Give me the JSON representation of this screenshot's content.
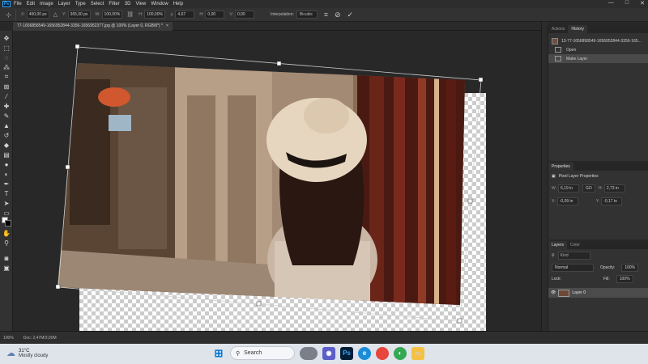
{
  "app": {
    "logo_text": "Ps"
  },
  "menu": [
    "File",
    "Edit",
    "Image",
    "Layer",
    "Type",
    "Select",
    "Filter",
    "3D",
    "View",
    "Window",
    "Help"
  ],
  "window_controls": [
    "—",
    "□",
    "✕"
  ],
  "options_bar": {
    "x_label": "X:",
    "x_value": "400,00 px",
    "y_label": "Y:",
    "y_value": "365,00 px",
    "w_label": "W:",
    "w_value": "100,00%",
    "h_label": "H:",
    "h_value": "100,00%",
    "angle_label": "∠",
    "angle_value": "4,67",
    "hskew_label": "H:",
    "hskew_value": "0,00",
    "vskew_label": "V:",
    "vskew_value": "0,00",
    "interp_label": "Interpolation:",
    "interp_value": "Bicubic"
  },
  "document_tab": {
    "title": "77-1656858549-1656952844-3356-1656952377.jpg @ 100% (Layer 0, RGB/8*) *",
    "close": "×"
  },
  "panels": {
    "history": {
      "tabs": [
        "Actions",
        "History"
      ],
      "snapshot": "13-77-1656858549-1656952844-3356-165...",
      "items": [
        "Open",
        "Make Layer"
      ]
    },
    "properties": {
      "tab": "Properties",
      "title": "Pixel Layer Properties",
      "w_label": "W:",
      "w_value": "6,19 in",
      "h_label": "H:",
      "h_value": "2,73 in",
      "x_label": "X:",
      "x_value": "-0,09 in",
      "y_label": "Y:",
      "y_value": "-0,17 in",
      "link_icon": "GO"
    },
    "layers": {
      "tabs": [
        "Layers",
        "Color"
      ],
      "kind_placeholder": "Kind",
      "blend_mode": "Normal",
      "opacity_label": "Opacity:",
      "opacity_value": "100%",
      "lock_label": "Lock:",
      "fill_label": "Fill:",
      "fill_value": "100%",
      "layer_name": "Layer 0"
    }
  },
  "status_bar": {
    "zoom": "100%",
    "doc_info": "Doc: 2,47M/3,90M"
  },
  "taskbar": {
    "temperature": "31°C",
    "weather": "Mostly cloudy",
    "search_label": "Search",
    "ps_label": "Ps"
  }
}
